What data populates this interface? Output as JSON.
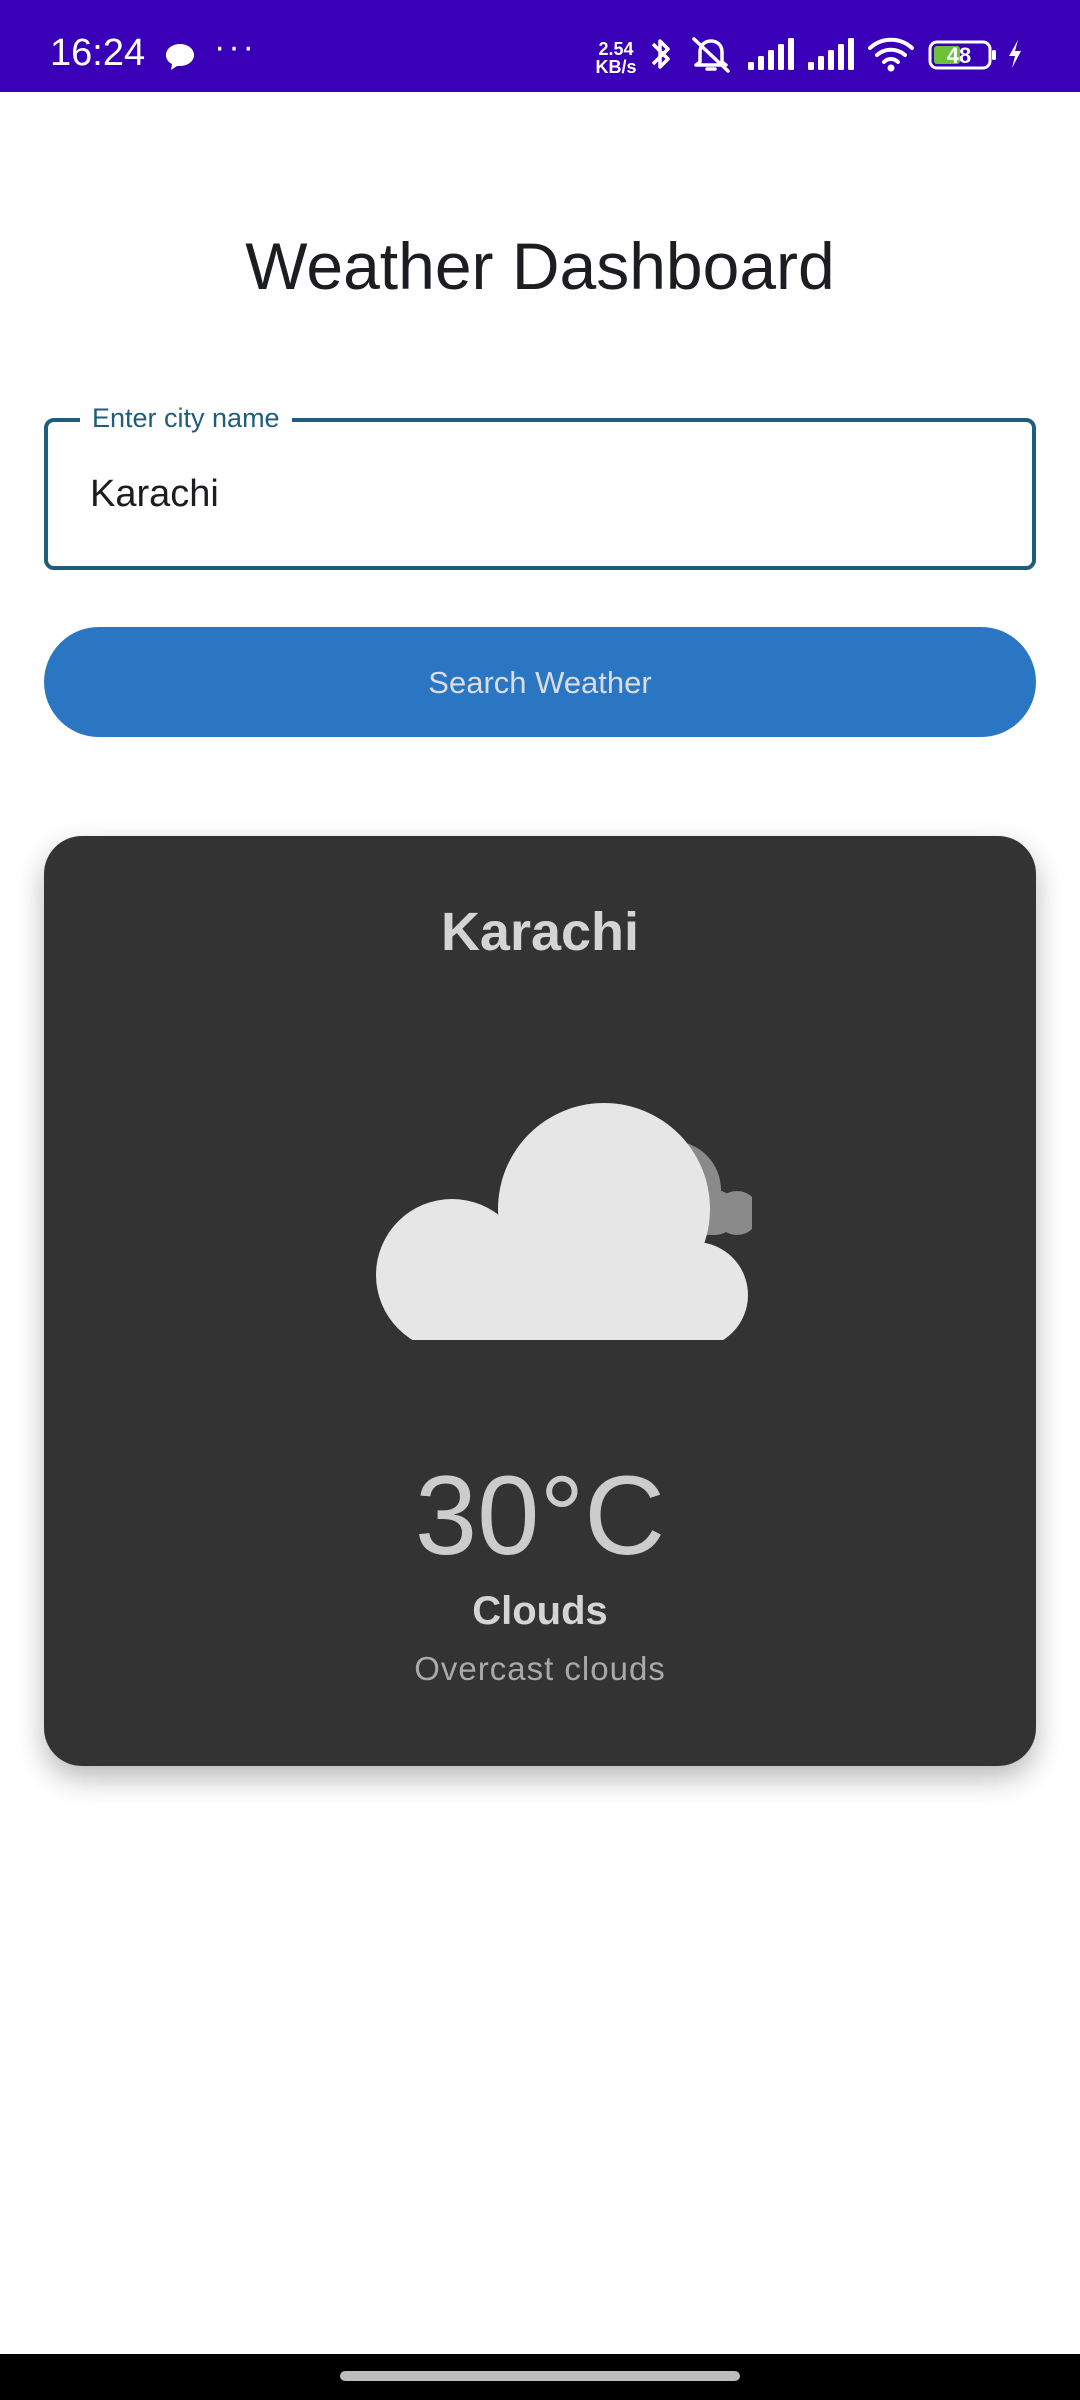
{
  "status_bar": {
    "time": "16:24",
    "net_speed_value": "2.54",
    "net_speed_unit": "KB/s",
    "battery_level": "48",
    "background_color": "#3a00b8",
    "icons": [
      "chat-bubble-icon",
      "more-dots-icon",
      "bluetooth-icon",
      "mute-icon",
      "signal-icon",
      "signal-icon",
      "wifi-icon",
      "battery-icon",
      "charging-icon"
    ]
  },
  "page": {
    "title": "Weather Dashboard"
  },
  "search": {
    "field_label": "Enter city name",
    "field_value": "Karachi",
    "button_label": "Search Weather",
    "accent_color": "#1e5d7c",
    "button_color": "#2b76c2"
  },
  "weather_card": {
    "city": "Karachi",
    "icon": "cloudy-icon",
    "temperature": "30°C",
    "condition": "Clouds",
    "description": "Overcast clouds",
    "background_color": "#333333"
  }
}
